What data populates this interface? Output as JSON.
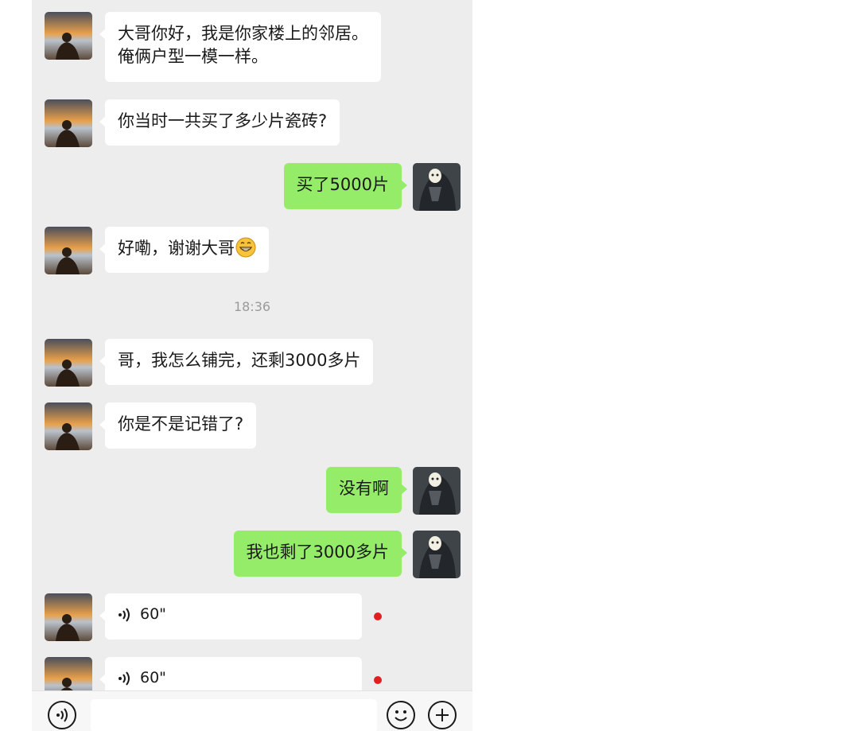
{
  "messages": [
    {
      "side": "left",
      "lines": [
        "大哥你好，我是你家楼上的邻居。",
        "俺俩户型一模一样。"
      ]
    },
    {
      "side": "left",
      "text": "你当时一共买了多少片瓷砖?"
    },
    {
      "side": "right",
      "text": "买了5000片"
    },
    {
      "side": "left",
      "text": "好嘞，谢谢大哥",
      "emoji": "grinning-face-icon"
    },
    {
      "type": "time",
      "text": "18:36"
    },
    {
      "side": "left",
      "text": "哥，我怎么铺完，还剩3000多片"
    },
    {
      "side": "left",
      "text": "你是不是记错了?"
    },
    {
      "side": "right",
      "text": "没有啊"
    },
    {
      "side": "right",
      "text": "我也剩了3000多片"
    },
    {
      "side": "left",
      "type": "voice",
      "duration": "60\"",
      "unread": true
    },
    {
      "side": "left",
      "type": "voice",
      "duration": "60\"",
      "unread": true
    }
  ],
  "colors": {
    "chat_background": "#ededed",
    "self_bubble": "#95ec69",
    "other_bubble": "#ffffff",
    "unread_dot": "#e02020"
  },
  "input_bar": {
    "voice_icon": "voice-mode-icon",
    "emoji_icon": "emoji-icon",
    "plus_icon": "plus-icon"
  }
}
